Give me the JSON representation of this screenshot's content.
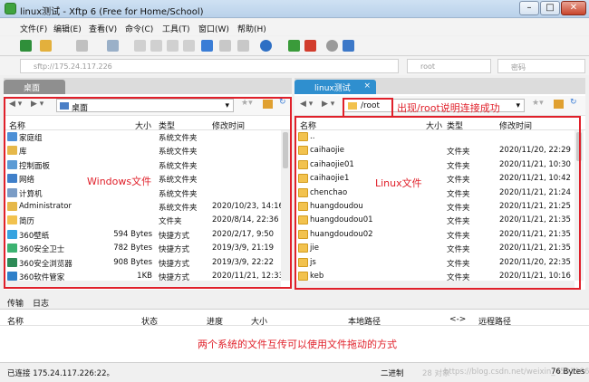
{
  "window": {
    "title": "linux测试 - Xftp 6 (Free for Home/School)"
  },
  "menu": [
    "文件(F)",
    "编辑(E)",
    "查看(V)",
    "命令(C)",
    "工具(T)",
    "窗口(W)",
    "帮助(H)"
  ],
  "address": {
    "host": "sftp://175.24.117.226",
    "user": "root",
    "password": "密码"
  },
  "left": {
    "tab": "桌面",
    "path": "桌面",
    "headers": {
      "name": "名称",
      "size": "大小",
      "type": "类型",
      "mtime": "修改时间"
    },
    "rows": [
      {
        "name": "家庭组",
        "size": "",
        "type": "系统文件夹",
        "mtime": "",
        "color": "#4c8fd6"
      },
      {
        "name": "库",
        "size": "",
        "type": "系统文件夹",
        "mtime": "",
        "color": "#e6b84a"
      },
      {
        "name": "控制面板",
        "size": "",
        "type": "系统文件夹",
        "mtime": "",
        "color": "#5b9bd5"
      },
      {
        "name": "网络",
        "size": "",
        "type": "系统文件夹",
        "mtime": "",
        "color": "#3f7fc9"
      },
      {
        "name": "计算机",
        "size": "",
        "type": "系统文件夹",
        "mtime": "",
        "color": "#7a9cc6"
      },
      {
        "name": "Administrator",
        "size": "",
        "type": "系统文件夹",
        "mtime": "2020/10/23, 14:16",
        "color": "#e6b84a"
      },
      {
        "name": "简历",
        "size": "",
        "type": "文件夹",
        "mtime": "2020/8/14, 22:36",
        "color": "#f2c24e"
      },
      {
        "name": "360壁纸",
        "size": "594 Bytes",
        "type": "快捷方式",
        "mtime": "2020/2/17, 9:50",
        "color": "#36a3e0"
      },
      {
        "name": "360安全卫士",
        "size": "782 Bytes",
        "type": "快捷方式",
        "mtime": "2019/3/9, 21:19",
        "color": "#3cb371"
      },
      {
        "name": "360安全浏览器",
        "size": "908 Bytes",
        "type": "快捷方式",
        "mtime": "2019/3/9, 22:22",
        "color": "#2e8b57"
      },
      {
        "name": "360软件管家",
        "size": "1KB",
        "type": "快捷方式",
        "mtime": "2020/11/21, 12:33",
        "color": "#2f80c9"
      }
    ],
    "annotation": "Windows文件"
  },
  "right": {
    "tab": "linux测试",
    "path": "/root",
    "path_annotation": "出现/root说明连接成功",
    "headers": {
      "name": "名称",
      "size": "大小",
      "type": "类型",
      "mtime": "修改时间"
    },
    "rows": [
      {
        "name": "..",
        "type": "",
        "mtime": ""
      },
      {
        "name": "caihaojie",
        "type": "文件夹",
        "mtime": "2020/11/20, 22:29"
      },
      {
        "name": "caihaojie01",
        "type": "文件夹",
        "mtime": "2020/11/21, 10:30"
      },
      {
        "name": "caihaojie1",
        "type": "文件夹",
        "mtime": "2020/11/21, 10:42"
      },
      {
        "name": "chenchao",
        "type": "文件夹",
        "mtime": "2020/11/21, 21:24"
      },
      {
        "name": "huangdoudou",
        "type": "文件夹",
        "mtime": "2020/11/21, 21:25"
      },
      {
        "name": "huangdoudou01",
        "type": "文件夹",
        "mtime": "2020/11/21, 21:35"
      },
      {
        "name": "huangdoudou02",
        "type": "文件夹",
        "mtime": "2020/11/21, 21:35"
      },
      {
        "name": "jie",
        "type": "文件夹",
        "mtime": "2020/11/21, 21:35"
      },
      {
        "name": "js",
        "type": "文件夹",
        "mtime": "2020/11/20, 22:35"
      },
      {
        "name": "keb",
        "type": "文件夹",
        "mtime": "2020/11/21, 10:16"
      }
    ],
    "annotation": "Linux文件"
  },
  "transfer": {
    "tabs": [
      "传输",
      "日志"
    ],
    "headers": [
      "名称",
      "状态",
      "进度",
      "大小",
      "本地路径",
      "<->",
      "远程路径"
    ],
    "annotation": "两个系统的文件互传可以使用文件拖动的方式"
  },
  "status": {
    "left": "已连接 175.24.117.226:22。",
    "mid": "二进制",
    "items": "28 对象",
    "size": "76 Bytes",
    "watermark": "https://blog.csdn.net/weixin_45019864"
  }
}
